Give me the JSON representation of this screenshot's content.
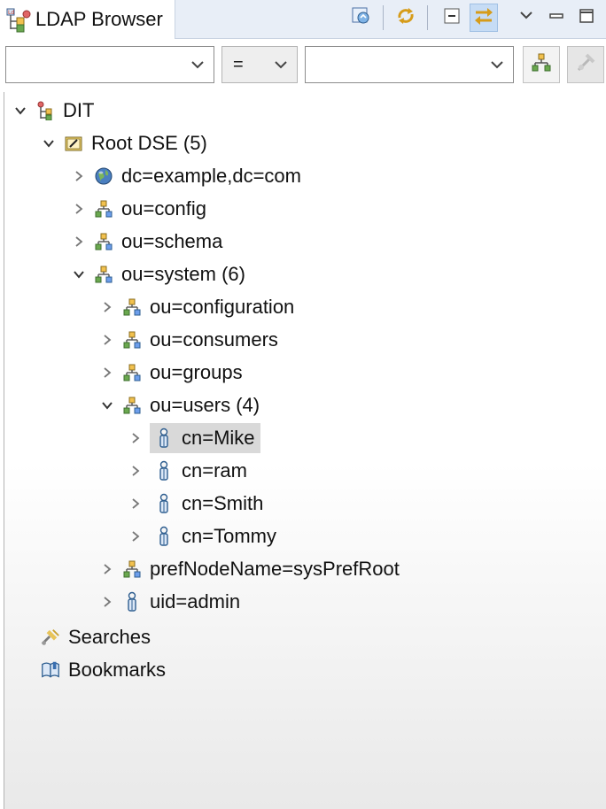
{
  "window": {
    "title": "LDAP Browser"
  },
  "filter": {
    "attribute": "",
    "operator": "=",
    "value": ""
  },
  "icons": {
    "tab": "ldap-browser-icon",
    "toolbar": [
      "link-with-editor-icon",
      "refresh-icon",
      "collapse-all-icon",
      "link-toggle-icon",
      "view-menu-icon",
      "minimize-icon",
      "maximize-icon"
    ],
    "filter_buttons": [
      "apply-filter-icon",
      "clear-filter-icon"
    ]
  },
  "colors": {
    "tab_bar": "#e8eef7",
    "selection": "#d9d9d9",
    "pressed_button": "#c6dcf5"
  },
  "tree": [
    {
      "label": "DIT",
      "icon": "dit-icon",
      "state": "expanded"
    },
    {
      "label": "Root DSE (5)",
      "icon": "root-dse-icon",
      "state": "expanded"
    },
    {
      "label": "dc=example,dc=com",
      "icon": "globe-icon",
      "state": "collapsed"
    },
    {
      "label": "ou=config",
      "icon": "org-unit-icon",
      "state": "collapsed"
    },
    {
      "label": "ou=schema",
      "icon": "org-unit-icon",
      "state": "collapsed"
    },
    {
      "label": "ou=system (6)",
      "icon": "org-unit-icon",
      "state": "expanded"
    },
    {
      "label": "ou=configuration",
      "icon": "org-unit-icon",
      "state": "collapsed"
    },
    {
      "label": "ou=consumers",
      "icon": "org-unit-icon",
      "state": "collapsed"
    },
    {
      "label": "ou=groups",
      "icon": "org-unit-icon",
      "state": "collapsed"
    },
    {
      "label": "ou=users (4)",
      "icon": "org-unit-icon",
      "state": "expanded"
    },
    {
      "label": "cn=Mike",
      "icon": "person-icon",
      "state": "collapsed",
      "selected": true
    },
    {
      "label": "cn=ram",
      "icon": "person-icon",
      "state": "collapsed"
    },
    {
      "label": "cn=Smith",
      "icon": "person-icon",
      "state": "collapsed"
    },
    {
      "label": "cn=Tommy",
      "icon": "person-icon",
      "state": "collapsed"
    },
    {
      "label": "prefNodeName=sysPrefRoot",
      "icon": "org-unit-icon",
      "state": "collapsed"
    },
    {
      "label": "uid=admin",
      "icon": "person-icon",
      "state": "collapsed"
    },
    {
      "label": "Searches",
      "icon": "searches-icon",
      "state": "none"
    },
    {
      "label": "Bookmarks",
      "icon": "bookmarks-icon",
      "state": "none"
    }
  ]
}
